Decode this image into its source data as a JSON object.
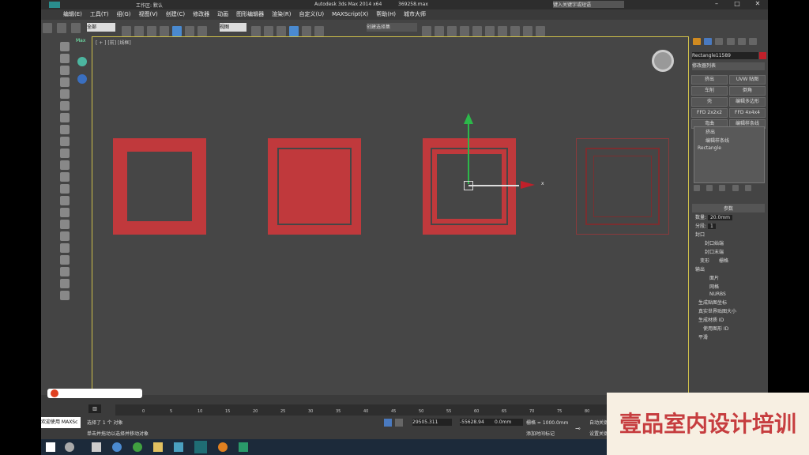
{
  "app": {
    "title": "Autodesk 3ds Max 2014 x64",
    "file": "369258.max",
    "workspace": "工作区: 默认",
    "search_placeholder": "键入关键字或短语"
  },
  "menu": [
    "编辑(E)",
    "工具(T)",
    "组(G)",
    "视图(V)",
    "创建(C)",
    "修改器",
    "动画",
    "图形编辑器",
    "渲染(R)",
    "自定义(U)",
    "MAXScript(X)",
    "帮助(H)",
    "城市大师"
  ],
  "toolbar": {
    "filter": "全部",
    "view": "视图",
    "selection_set": "创建选择集"
  },
  "viewport": {
    "label": "[ + ] [前] [线框]",
    "axis_x": "x"
  },
  "command_panel": {
    "object_name": "Rectangle11589",
    "modifier_list": "修改器列表",
    "modifier_buttons": [
      "挤出",
      "UVW 贴图",
      "车削",
      "倒角",
      "壳",
      "编辑多边形",
      "FFD 2x2x2",
      "FFD 4x4x4",
      "弯曲",
      "编辑样条线"
    ],
    "stack": [
      "挤出",
      "编辑样条线",
      "Rectangle"
    ],
    "params": {
      "section": "参数",
      "amount_label": "数量:",
      "amount": "20.0mm",
      "segments_label": "分段:",
      "segments": "1",
      "cap_section": "封口",
      "cap_start": "封口始端",
      "cap_end": "封口末端",
      "morph": "变形",
      "grid": "栅格",
      "output_section": "输出",
      "output_options": [
        "面片",
        "网格",
        "NURBS"
      ],
      "opt1": "生成贴图坐标",
      "opt2": "真实世界贴图大小",
      "opt3": "生成材质 ID",
      "opt4": "使用图形 ID",
      "opt5": "平滑"
    }
  },
  "timeline": {
    "frame": "0 / 100",
    "ticks": [
      "0",
      "5",
      "10",
      "15",
      "20",
      "25",
      "30",
      "35",
      "40",
      "45",
      "50",
      "55",
      "60",
      "65",
      "70",
      "75",
      "80"
    ]
  },
  "status": {
    "selection": "选择了 1 个 对象",
    "hint": "单击并拖动以选择并移动对象",
    "welcome": "欢迎使用 MAXSc",
    "x": "29505.311",
    "y": "-55628.94",
    "z": "0.0mm",
    "grid": "栅格 = 1000.0mm",
    "add_key": "添加时间标记",
    "auto_key": "自动关键点",
    "set_key": "设置关键点"
  },
  "watermark": "壹品室内设计培训"
}
